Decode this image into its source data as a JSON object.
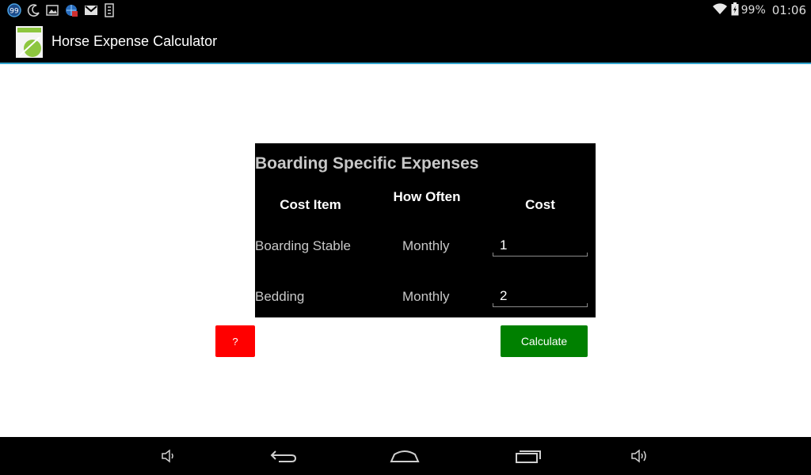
{
  "status_bar": {
    "notification_badge": "99",
    "battery_percent": "99%",
    "time": "01:06"
  },
  "app_bar": {
    "title": "Horse Expense Calculator"
  },
  "panel": {
    "title": "Boarding Specific Expenses",
    "headers": {
      "cost_item": "Cost Item",
      "how_often": "How Often",
      "cost": "Cost"
    },
    "rows": [
      {
        "item": "Boarding Stable",
        "frequency": "Monthly",
        "cost": "1"
      },
      {
        "item": "Bedding",
        "frequency": "Monthly",
        "cost": "2"
      }
    ]
  },
  "buttons": {
    "help": "?",
    "calculate": "Calculate"
  },
  "colors": {
    "accent_line": "#33a5cf",
    "help_button": "#ff0000",
    "calculate_button": "#008000"
  }
}
